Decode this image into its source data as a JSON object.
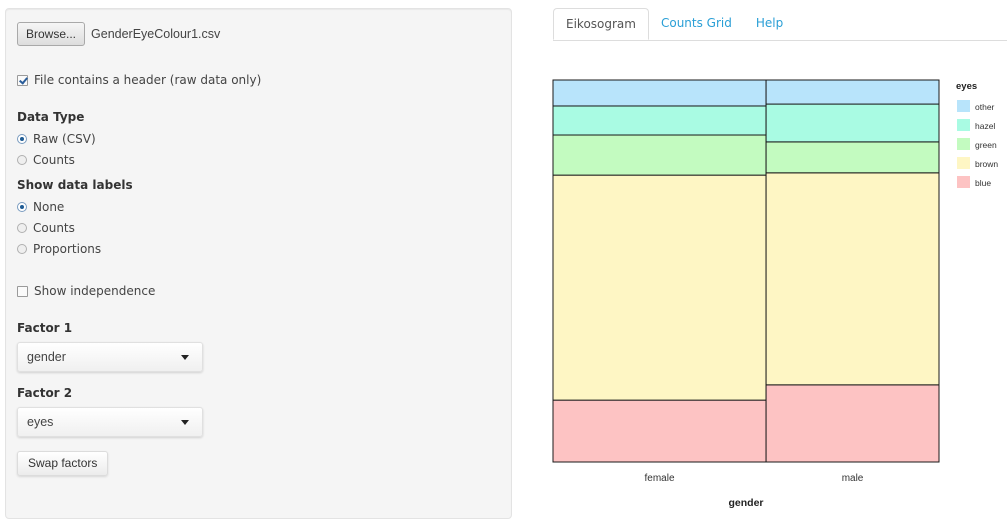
{
  "sidebar": {
    "browse_label": "Browse...",
    "file_name": "GenderEyeColour1.csv",
    "header_checkbox": {
      "label": "File contains a header (raw data only)",
      "checked": true
    },
    "data_type": {
      "label": "Data Type",
      "options": [
        {
          "label": "Raw (CSV)",
          "selected": true
        },
        {
          "label": "Counts",
          "selected": false
        }
      ]
    },
    "data_labels": {
      "label": "Show data labels",
      "options": [
        {
          "label": "None",
          "selected": true
        },
        {
          "label": "Counts",
          "selected": false
        },
        {
          "label": "Proportions",
          "selected": false
        }
      ]
    },
    "independence_checkbox": {
      "label": "Show independence",
      "checked": false
    },
    "factor1": {
      "label": "Factor 1",
      "value": "gender"
    },
    "factor2": {
      "label": "Factor 2",
      "value": "eyes"
    },
    "swap_label": "Swap factors"
  },
  "tabs": [
    {
      "label": "Eikosogram",
      "active": true
    },
    {
      "label": "Counts Grid",
      "active": false
    },
    {
      "label": "Help",
      "active": false
    }
  ],
  "colors": {
    "other": "#b8e4fb",
    "hazel": "#a9fbe3",
    "green": "#c3fbc0",
    "brown": "#fef6c4",
    "blue": "#fdc3c3",
    "tab_link": "#2a9fd6"
  },
  "chart_data": {
    "type": "eikosogram",
    "xlabel": "gender",
    "ylabel": "",
    "legend_title": "eyes",
    "legend_position": "right",
    "legend_entries": [
      "other",
      "hazel",
      "green",
      "brown",
      "blue"
    ],
    "categories": [
      "female",
      "male"
    ],
    "category_widths": [
      0.552,
      0.448
    ],
    "stack_order_bottom_to_top": [
      "blue",
      "brown",
      "green",
      "hazel",
      "other"
    ],
    "series": [
      {
        "name": "blue",
        "values": [
          0.162,
          0.202
        ]
      },
      {
        "name": "brown",
        "values": [
          0.589,
          0.555
        ]
      },
      {
        "name": "green",
        "values": [
          0.105,
          0.081
        ]
      },
      {
        "name": "hazel",
        "values": [
          0.076,
          0.099
        ]
      },
      {
        "name": "other",
        "values": [
          0.068,
          0.063
        ]
      }
    ],
    "ylim": [
      0,
      1
    ],
    "grid": false
  }
}
